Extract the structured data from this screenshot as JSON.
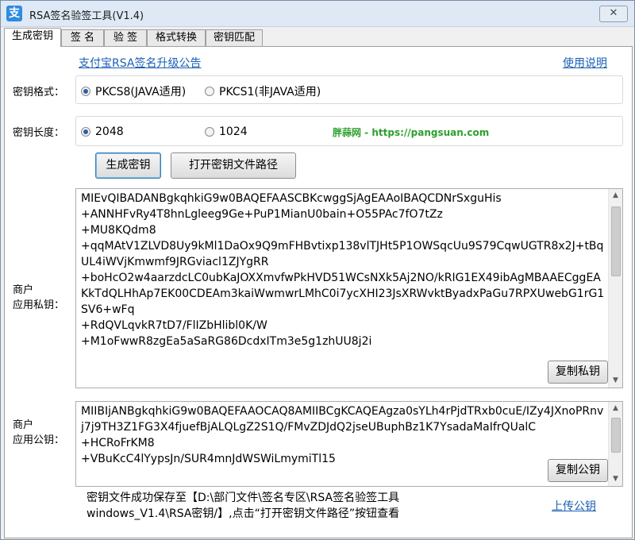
{
  "window": {
    "icon_glyph": "支",
    "title": "RSA签名验签工具(V1.4)",
    "close_glyph": "✕"
  },
  "tabs": [
    {
      "label": "生成密钥",
      "active": true
    },
    {
      "label": "签 名",
      "active": false
    },
    {
      "label": "验 签",
      "active": false
    },
    {
      "label": "格式转换",
      "active": false
    },
    {
      "label": "密钥匹配",
      "active": false
    }
  ],
  "header": {
    "announcement_link": "支付宝RSA签名升级公告",
    "help_link": "使用说明"
  },
  "key_format": {
    "label": "密钥格式：",
    "options": [
      "PKCS8(JAVA适用)",
      "PKCS1(非JAVA适用)"
    ],
    "selected": "PKCS8(JAVA适用)"
  },
  "key_length": {
    "label": "密钥长度：",
    "options": [
      "2048",
      "1024"
    ],
    "selected": "2048"
  },
  "watermark": "胖蒜网 - https://pangsuan.com",
  "buttons": {
    "generate": "生成密钥",
    "open_path": "打开密钥文件路径",
    "copy_private": "复制私钥",
    "copy_public": "复制公钥"
  },
  "private_key": {
    "label_line1": "商户",
    "label_line2": "应用私钥：",
    "text": "MIEvQIBADANBgkqhkiG9w0BAQEFAASCBKcwggSjAgEAAoIBAQCDNrSxguHis\n+ANNHFvRy4T8hnLgleeg9Ge+PuP1MianU0bain+O55PAc7fO7tZz\n+MU8KQdm8\n+qqMAtV1ZLVD8Uy9kMl1DaOx9Q9mFHBvtixp138vlTJHt5P1OWSqcUu9S79CqwUGTR8x2J+tBqUL4iWVjKmwmf9JRGviacl1ZJYgRR\n+boHcO2w4aarzdcLC0ubKaJOXXmvfwPkHVD51WCsNXk5Aj2NO/kRIG1EX49ibAgMBAAECggEAKkTdQLHhAp7EK00CDEAm3kaiWwmwrLMhC0i7ycXHI23JsXRWvktByadxPaGu7RPXUwebG1rG1SV6+wFq\n+RdQVLqvkR7tD7/FlIZbHlibl0K/W\n+M1oFwwR8zgEa5aSaRG86DcdxITm3e5g1zhUU8j2i"
  },
  "public_key": {
    "label_line1": "商户",
    "label_line2": "应用公钥：",
    "text": "MIIBIjANBgkqhkiG9w0BAQEFAAOCAQ8AMIIBCgKCAQEAgza0sYLh4rPjdTRxb0cuE/IZy4JXnoPRnvj7j9TH3Z1FG3X4fjuefBjALQLgZ2S1Q/FMvZDJdQ2jseUBuphBz1K7YsadaMaIfrQUalC\n+HCRoFrKM8\n+VBuKcC4lYypsJn/SUR4mnJdWSWiLmymiTl15"
  },
  "status": {
    "line1": "密钥文件成功保存至【D:\\部门文件\\签名专区\\RSA签名验签工具",
    "line2": "windows_V1.4\\RSA密钥/】,点击“打开密钥文件路径”按钮查看"
  },
  "upload_link": "上传公钥"
}
